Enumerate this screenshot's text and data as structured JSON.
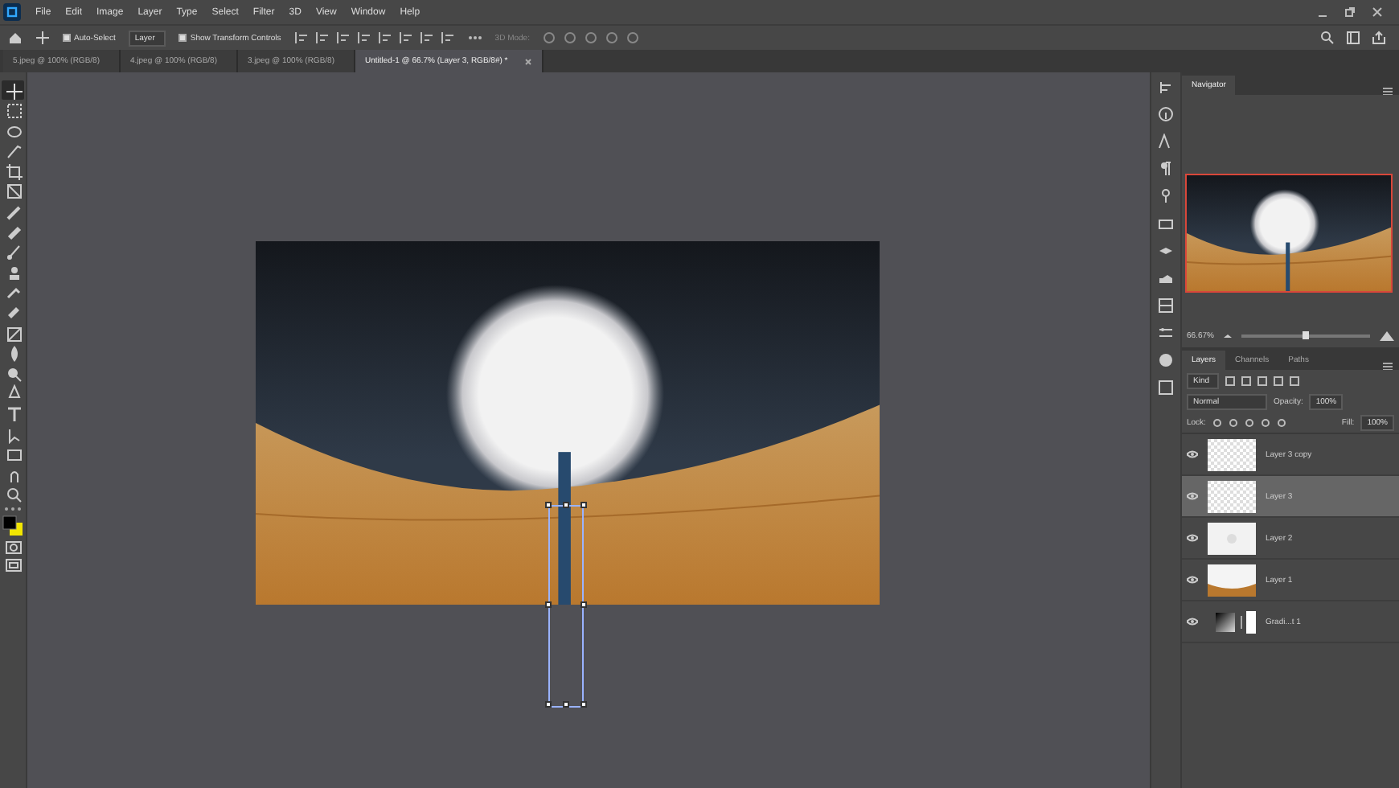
{
  "menu": [
    "File",
    "Edit",
    "Image",
    "Layer",
    "Type",
    "Select",
    "Filter",
    "3D",
    "View",
    "Window",
    "Help"
  ],
  "options_bar": {
    "auto_select": {
      "label": "Auto-Select",
      "checked": true
    },
    "target": "Layer",
    "show_transform": {
      "label": "Show Transform Controls",
      "checked": true
    },
    "mode_label": "3D Mode:"
  },
  "document_tabs": [
    {
      "label": "5.jpeg @ 100% (RGB/8)",
      "selected": false
    },
    {
      "label": "4.jpeg @ 100% (RGB/8)",
      "selected": false
    },
    {
      "label": "3.jpeg @ 100% (RGB/8)",
      "selected": false
    },
    {
      "label": "Untitled-1 @ 66.7% (Layer 3, RGB/8#) *",
      "selected": true
    }
  ],
  "tools": [
    {
      "selected": true
    },
    {
      "selected": false
    },
    {
      "selected": false
    },
    {
      "selected": false
    },
    {
      "selected": false
    },
    {
      "selected": false
    },
    {
      "selected": false
    },
    {
      "selected": false
    },
    {
      "selected": false
    },
    {
      "selected": false
    },
    {
      "selected": false
    },
    {
      "selected": false
    },
    {
      "selected": false
    },
    {
      "selected": false
    },
    {
      "selected": false
    },
    {
      "selected": false
    },
    {
      "selected": false
    },
    {
      "selected": false
    },
    {
      "selected": false
    },
    {
      "selected": false
    },
    {
      "selected": false
    }
  ],
  "navigator": {
    "title": "Navigator",
    "zoom": "66.67%",
    "level": 0.5
  },
  "layers_panel": {
    "tabs": [
      {
        "label": "Layers",
        "selected": true
      },
      {
        "label": "Channels",
        "selected": false
      },
      {
        "label": "Paths",
        "selected": false
      }
    ],
    "filter": "Kind",
    "blend_mode": "Normal",
    "opacity_label": "Opacity:",
    "opacity": "100%",
    "lock_label": "Lock:",
    "fill_label": "Fill:",
    "fill": "100%",
    "layers": [
      {
        "name": "Layer 3 copy",
        "kind": "transparent",
        "selected": false,
        "visible": true
      },
      {
        "name": "Layer 3",
        "kind": "transparent",
        "selected": true,
        "visible": true
      },
      {
        "name": "Layer 2",
        "kind": "moon",
        "selected": false,
        "visible": true
      },
      {
        "name": "Layer 1",
        "kind": "desert",
        "selected": false,
        "visible": true
      },
      {
        "name": "Gradi...t 1",
        "kind": "gradient",
        "selected": false,
        "visible": true
      }
    ]
  }
}
